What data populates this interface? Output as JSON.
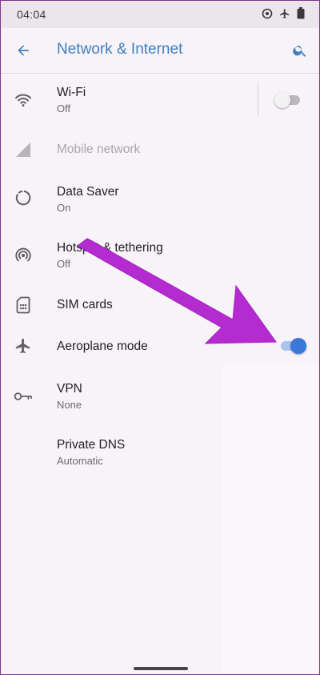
{
  "status": {
    "time": "04:04"
  },
  "header": {
    "title": "Network & Internet"
  },
  "items": [
    {
      "title": "Wi-Fi",
      "subtitle": "Off"
    },
    {
      "title": "Mobile network"
    },
    {
      "title": "Data Saver",
      "subtitle": "On"
    },
    {
      "title": "Hotspot & tethering",
      "subtitle": "Off"
    },
    {
      "title": "SIM cards"
    },
    {
      "title": "Aeroplane mode"
    },
    {
      "title": "VPN",
      "subtitle": "None"
    },
    {
      "title": "Private DNS",
      "subtitle": "Automatic"
    }
  ],
  "toggles": {
    "wifi_on": false,
    "aeroplane_on": true
  },
  "colors": {
    "accent": "#3f7fc0",
    "switch_on_thumb": "#3a78d8",
    "switch_on_track": "#a9c5ef",
    "switch_off_thumb": "#f2f2f2",
    "switch_off_track": "#b9b9b9",
    "annotation_arrow": "#b42bd0"
  },
  "icons": {
    "back": "arrow-left-icon",
    "search": "search-icon",
    "wifi": "wifi-icon",
    "mobile": "signal-icon",
    "data_saver": "data-saver-icon",
    "hotspot": "hotspot-icon",
    "sim": "sim-card-icon",
    "aeroplane": "airplane-icon",
    "vpn": "key-icon"
  }
}
